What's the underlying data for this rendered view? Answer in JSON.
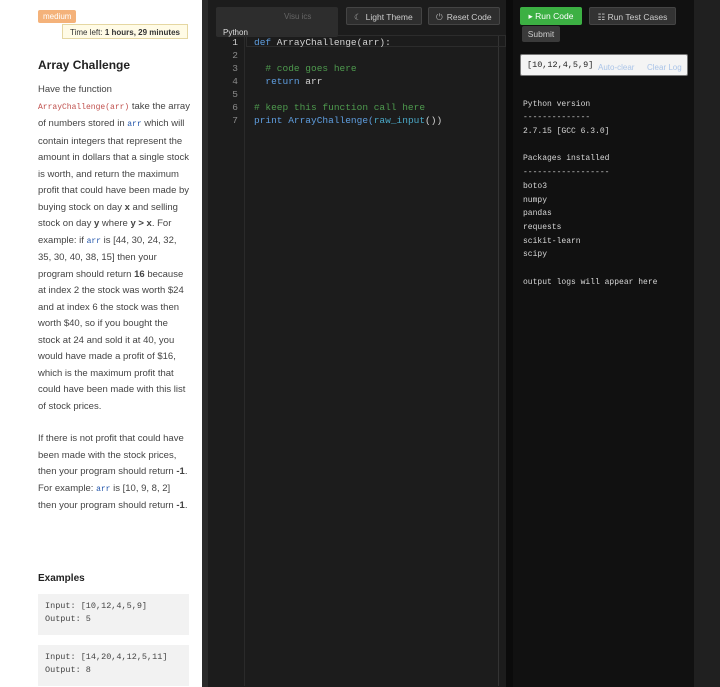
{
  "problem": {
    "difficulty": "medium",
    "timer_label": "Time left:",
    "timer_value": "1 hours, 29 minutes",
    "title": "Array Challenge",
    "p1": {
      "t1": "Have the function ",
      "fn": "ArrayChallenge(arr)",
      "t2": " take the array of numbers stored in ",
      "arr1": "arr",
      "t3": " which will contain integers that represent the amount in dollars that a single stock is worth, and return the maximum profit that could have been made by buying stock on day ",
      "x1": "x",
      "t4": " and selling stock on day ",
      "y1": "y",
      "t5": " where ",
      "yx": "y > x",
      "t6": ". For example: if ",
      "arr2": "arr",
      "t7": " is [44, 30, 24, 32, 35, 30, 40, 38, 15] then your program should return ",
      "ret": "16",
      "t8": " because at index 2 the stock was worth $24 and at index 6 the stock was then worth $40, so if you bought the stock at 24 and sold it at 40, you would have made a profit of $16, which is the maximum profit that could have been made with this list of stock prices."
    },
    "p2": {
      "t1": "If there is not profit that could have been made with the stock prices, then your program should return ",
      "neg1": "-1",
      "t2": ". For example: ",
      "arr": "arr",
      "t3": " is [10, 9, 8, 2] then your program should return ",
      "neg2": "-1",
      "t4": "."
    },
    "examples_heading": "Examples",
    "examples": [
      {
        "input": "Input: [10,12,4,5,9]",
        "output": "Output: 5"
      },
      {
        "input": "Input: [14,20,4,12,5,11]",
        "output": "Output: 8"
      }
    ]
  },
  "editor": {
    "ghost_label": "Visu  ics",
    "language": "Python",
    "light_theme_label": "Light Theme",
    "reset_label": "Reset Code",
    "line_numbers": [
      "1",
      "2",
      "3",
      "4",
      "5",
      "6",
      "7"
    ],
    "lines": {
      "l1_kw": "def",
      "l1_rest": " ArrayChallenge(arr):",
      "l3": "  # code goes here",
      "l4_kw": "  return",
      "l4_rest": " arr",
      "l6": "# keep this function call here",
      "l7_a": "print ArrayChallenge(",
      "l7_b": "raw_input",
      "l7_c": "())"
    }
  },
  "console": {
    "run_label": "Run Code",
    "tests_label": "Run Test Cases",
    "submit_label": "Submit",
    "input_value": "[10,12,4,5,9]",
    "auto_clear": "Auto-clear",
    "clear_log": "Clear Log",
    "output": [
      "Python version",
      "--------------",
      "2.7.15 [GCC 6.3.0]",
      "",
      "Packages installed",
      "------------------",
      "boto3",
      "numpy",
      "pandas",
      "requests",
      "scikit-learn",
      "scipy",
      "",
      "output logs will appear here"
    ]
  }
}
